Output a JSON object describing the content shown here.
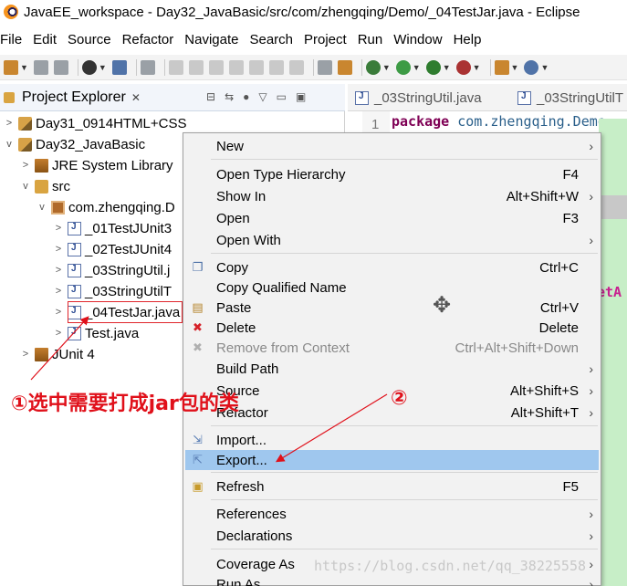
{
  "window": {
    "title": "JavaEE_workspace - Day32_JavaBasic/src/com/zhengqing/Demo/_04TestJar.java - Eclipse"
  },
  "menubar": [
    "File",
    "Edit",
    "Source",
    "Refactor",
    "Navigate",
    "Search",
    "Project",
    "Run",
    "Window",
    "Help"
  ],
  "explorer": {
    "tab_label": "Project Explorer",
    "tree": [
      {
        "text": "Day31_0914HTML+CSS",
        "icon": "project-icon",
        "twisty": ">"
      },
      {
        "text": "Day32_JavaBasic",
        "icon": "project-icon",
        "twisty": "v"
      },
      {
        "text": "JRE System Library",
        "icon": "library-icon",
        "twisty": ">"
      },
      {
        "text": "src",
        "icon": "source-folder-icon",
        "twisty": "v"
      },
      {
        "text": "com.zhengqing.D",
        "icon": "package-icon",
        "twisty": "v"
      },
      {
        "text": "_01TestJUnit3",
        "icon": "java-file-icon",
        "twisty": ">"
      },
      {
        "text": "_02TestJUnit4",
        "icon": "java-file-icon",
        "twisty": ">"
      },
      {
        "text": "_03StringUtil.j",
        "icon": "java-file-icon",
        "twisty": ">"
      },
      {
        "text": "_03StringUtilT",
        "icon": "java-file-icon",
        "twisty": ">"
      },
      {
        "text": "_04TestJar.java",
        "icon": "java-file-icon",
        "twisty": ">"
      },
      {
        "text": "Test.java",
        "icon": "java-file-icon",
        "twisty": ">"
      },
      {
        "text": "JUnit 4",
        "icon": "library-icon",
        "twisty": ">"
      }
    ]
  },
  "editor": {
    "tabs": [
      "_03StringUtil.java",
      "_03StringUtilT"
    ],
    "line_number": "1",
    "code_keyword": "package",
    "code_package": "com.zhengqing.Demo",
    "brace": "{",
    "method_fragment": "etA"
  },
  "context_menu": {
    "items": [
      {
        "label": "New",
        "shortcut": "",
        "submenu": true,
        "icon": "",
        "disabled": false
      },
      {
        "label": "Open Type Hierarchy",
        "shortcut": "F4",
        "submenu": false,
        "icon": "",
        "disabled": false
      },
      {
        "label": "Show In",
        "shortcut": "Alt+Shift+W",
        "submenu": true,
        "icon": "",
        "disabled": false
      },
      {
        "label": "Open",
        "shortcut": "F3",
        "submenu": false,
        "icon": "",
        "disabled": false
      },
      {
        "label": "Open With",
        "shortcut": "",
        "submenu": true,
        "icon": "",
        "disabled": false
      },
      {
        "label": "Copy",
        "shortcut": "Ctrl+C",
        "submenu": false,
        "icon": "copy-icon",
        "disabled": false
      },
      {
        "label": "Copy Qualified Name",
        "shortcut": "",
        "submenu": false,
        "icon": "",
        "disabled": false
      },
      {
        "label": "Paste",
        "shortcut": "Ctrl+V",
        "submenu": false,
        "icon": "paste-icon",
        "disabled": false
      },
      {
        "label": "Delete",
        "shortcut": "Delete",
        "submenu": false,
        "icon": "delete-icon",
        "disabled": false
      },
      {
        "label": "Remove from Context",
        "shortcut": "Ctrl+Alt+Shift+Down",
        "submenu": false,
        "icon": "remove-icon",
        "disabled": true
      },
      {
        "label": "Build Path",
        "shortcut": "",
        "submenu": true,
        "icon": "",
        "disabled": false
      },
      {
        "label": "Source",
        "shortcut": "Alt+Shift+S",
        "submenu": true,
        "icon": "",
        "disabled": false
      },
      {
        "label": "Refactor",
        "shortcut": "Alt+Shift+T",
        "submenu": true,
        "icon": "",
        "disabled": false
      },
      {
        "label": "Import...",
        "shortcut": "",
        "submenu": false,
        "icon": "import-icon",
        "disabled": false
      },
      {
        "label": "Export...",
        "shortcut": "",
        "submenu": false,
        "icon": "export-icon",
        "disabled": false,
        "selected": true
      },
      {
        "label": "Refresh",
        "shortcut": "F5",
        "submenu": false,
        "icon": "refresh-icon",
        "disabled": false
      },
      {
        "label": "References",
        "shortcut": "",
        "submenu": true,
        "icon": "",
        "disabled": false
      },
      {
        "label": "Declarations",
        "shortcut": "",
        "submenu": true,
        "icon": "",
        "disabled": false
      },
      {
        "label": "Coverage As",
        "shortcut": "",
        "submenu": true,
        "icon": "",
        "disabled": false
      },
      {
        "label": "Run As",
        "shortcut": "",
        "submenu": true,
        "icon": "",
        "disabled": false
      }
    ]
  },
  "annotations": {
    "step1": "①选中需要打成jar包的类",
    "step2": "②"
  },
  "watermark": "https://blog.csdn.net/qq_38225558",
  "colors": {
    "selection": "#9fc7ee",
    "annotation": "#e0101a",
    "editor_ruler": "#c7eec7"
  }
}
